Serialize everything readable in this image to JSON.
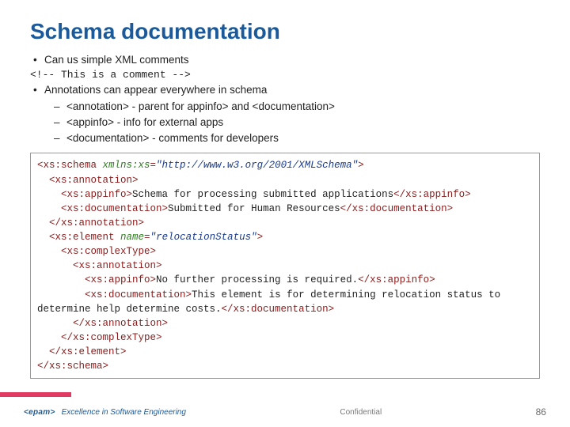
{
  "title": "Schema documentation",
  "bullets": {
    "l1a": "Can us simple XML comments",
    "mono": "<!-- This is a comment -->",
    "l1b": "Annotations can appear everywhere in schema",
    "l2a": "<annotation> - parent for appinfo> and <documentation>",
    "l2b": "<appinfo> - info for external apps",
    "l2c": "<documentation> - comments for developers"
  },
  "code": {
    "t01a": "<xs:schema ",
    "t01b": "xmlns:xs",
    "t01c": "=",
    "t01d": "\"http://www.w3.org/2001/XMLSchema\"",
    "t01e": ">",
    "t02": "  <xs:annotation>",
    "t03a": "    <xs:appinfo>",
    "t03b": "Schema for processing submitted applications",
    "t03c": "</xs:appinfo>",
    "t04a": "    <xs:documentation>",
    "t04b": "Submitted for Human Resources",
    "t04c": "</xs:documentation>",
    "t05": "  </xs:annotation>",
    "t06a": "  <xs:element ",
    "t06b": "name",
    "t06c": "=",
    "t06d": "\"relocationStatus\"",
    "t06e": ">",
    "t07": "    <xs:complexType>",
    "t08": "      <xs:annotation>",
    "t09a": "        <xs:appinfo>",
    "t09b": "No further processing is required.",
    "t09c": "</xs:appinfo>",
    "t10a": "        <xs:documentation>",
    "t10b": "This element is for determining relocation status to determine help determine costs.",
    "t10c": "</xs:documentation>",
    "t11": "      </xs:annotation>",
    "t12": "    </xs:complexType>",
    "t13": "  </xs:element>",
    "t14": "</xs:schema>"
  },
  "footer": {
    "brand": "<epam>",
    "tagline": "Excellence in Software Engineering",
    "confidential": "Confidential",
    "page": "86"
  }
}
